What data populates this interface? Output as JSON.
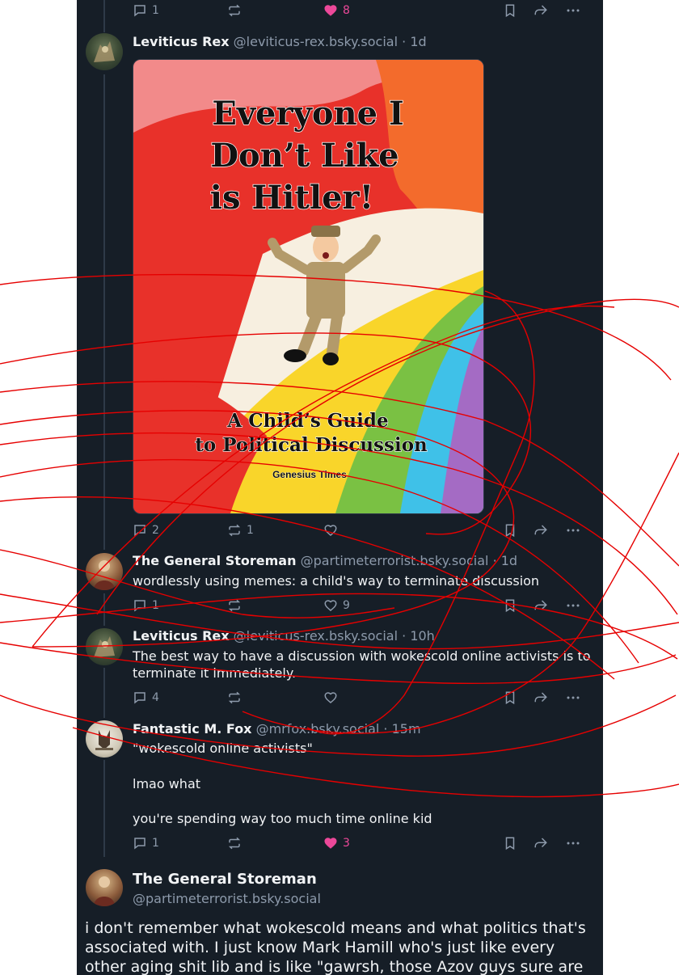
{
  "top_actions": {
    "reply_count": "1",
    "like_count": "8"
  },
  "posts": [
    {
      "name": "Leviticus Rex",
      "handle": "@leviticus-rex.bsky.social",
      "time": "· 1d",
      "image": {
        "title_line1": "Everyone I",
        "title_line2": "Don’t Like",
        "title_line3": "is Hitler!",
        "subtitle_line1": "A Child’s Guide",
        "subtitle_line2": "to Political  Discussion",
        "publisher": "Genesius Times"
      },
      "reply_count": "2",
      "repost_count": "1",
      "like_count": ""
    },
    {
      "name": "The General Storeman",
      "handle": "@partimeterrorist.bsky.social",
      "time": "· 1d",
      "text": "wordlessly using memes: a child's way to terminate discussion",
      "reply_count": "1",
      "repost_count": "",
      "like_count": "9"
    },
    {
      "name": "Leviticus Rex",
      "handle": "@leviticus-rex.bsky.social",
      "time": "· 10h",
      "text_line1": "The best way to have a discussion with wokescold online activists is to",
      "text_line2": "terminate it immediately.",
      "reply_count": "4",
      "repost_count": "",
      "like_count": ""
    },
    {
      "name": "Fantastic M. Fox",
      "handle": "@mrfox.bsky.social",
      "time": "· 15m",
      "text_line1": "\"wokescold online activists\"",
      "text_line2": "lmao what",
      "text_line3": "you're spending way too much time online kid",
      "reply_count": "1",
      "repost_count": "",
      "like_count": "3"
    }
  ],
  "main_post": {
    "name": "The General Storeman",
    "handle": "@partimeterrorist.bsky.social",
    "text": "i don't remember what wokescold means and what politics that's associated with. I just know Mark Hamill who's just like every other aging shit lib and is like \"gawrsh, those Azov guys sure are badass!\""
  },
  "icons": [
    "reply-icon",
    "repost-icon",
    "like-icon",
    "bookmark-icon",
    "share-icon",
    "more-icon"
  ],
  "colors": {
    "background": "#161e27",
    "accent_like": "#ec4899",
    "muted": "#8d9aab",
    "text": "#f1f3f5",
    "scribble": "#e60000"
  }
}
